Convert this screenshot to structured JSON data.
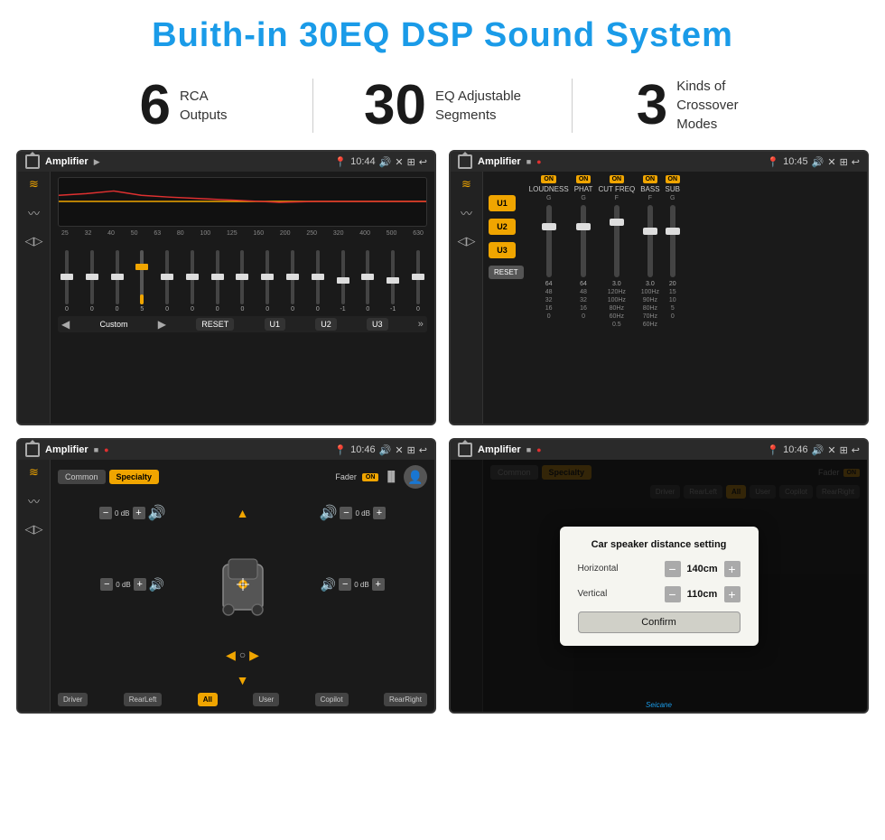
{
  "header": {
    "title": "Buith-in 30EQ DSP Sound System"
  },
  "stats": [
    {
      "number": "6",
      "label": "RCA\nOutputs"
    },
    {
      "number": "30",
      "label": "EQ Adjustable\nSegments"
    },
    {
      "number": "3",
      "label": "Kinds of\nCrossover Modes"
    }
  ],
  "screen1": {
    "app_title": "Amplifier",
    "time": "10:44",
    "eq_freqs": [
      "25",
      "32",
      "40",
      "50",
      "63",
      "80",
      "100",
      "125",
      "160",
      "200",
      "250",
      "320",
      "400",
      "500",
      "630"
    ],
    "eq_values": [
      "0",
      "0",
      "0",
      "5",
      "0",
      "0",
      "0",
      "0",
      "0",
      "0",
      "0",
      "-1",
      "0",
      "-1"
    ],
    "preset_label": "Custom",
    "buttons": [
      "RESET",
      "U1",
      "U2",
      "U3"
    ]
  },
  "screen2": {
    "app_title": "Amplifier",
    "time": "10:45",
    "u_labels": [
      "U1",
      "U2",
      "U3"
    ],
    "channels": [
      {
        "on": "ON",
        "name": "LOUDNESS"
      },
      {
        "on": "ON",
        "name": "PHAT"
      },
      {
        "on": "ON",
        "name": "CUT FREQ"
      },
      {
        "on": "ON",
        "name": "BASS"
      },
      {
        "on": "ON",
        "name": "SUB"
      }
    ],
    "reset_label": "RESET"
  },
  "screen3": {
    "app_title": "Amplifier",
    "time": "10:46",
    "tabs": [
      "Common",
      "Specialty"
    ],
    "fader_label": "Fader",
    "on_label": "ON",
    "db_values": [
      "0 dB",
      "0 dB",
      "0 dB",
      "0 dB"
    ],
    "buttons": [
      "Driver",
      "RearLeft",
      "All",
      "User",
      "Copilot",
      "RearRight"
    ]
  },
  "screen4": {
    "app_title": "Amplifier",
    "time": "10:46",
    "dialog": {
      "title": "Car speaker distance setting",
      "horizontal_label": "Horizontal",
      "horizontal_value": "140cm",
      "vertical_label": "Vertical",
      "vertical_value": "110cm",
      "confirm_label": "Confirm"
    },
    "tabs": [
      "Common",
      "Specialty"
    ],
    "buttons": [
      "Driver",
      "RearLeft",
      "User",
      "Copilot",
      "RearRight"
    ],
    "watermark": "Seicane"
  }
}
